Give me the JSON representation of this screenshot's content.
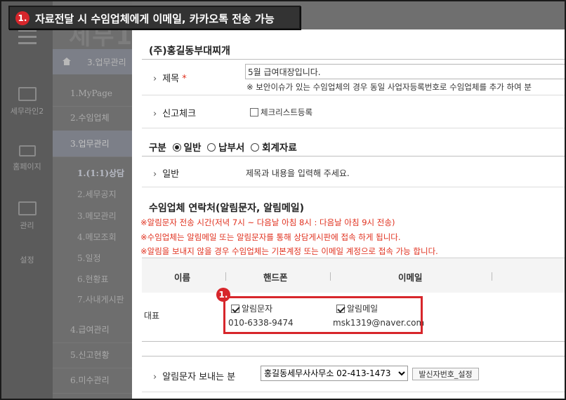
{
  "annotation": {
    "number": "1.",
    "banner_text": "자료전달 시 수임업체에게 이메일, 카카오톡 전송 가능"
  },
  "brand_partial": "세무1",
  "rail": {
    "items": [
      {
        "label": "세무라인2",
        "icon": "document-icon"
      },
      {
        "label": "홈페이지",
        "icon": "monitor-icon"
      },
      {
        "label": "관리",
        "icon": "document-icon"
      },
      {
        "label": "설정",
        "icon": "gear-icon"
      }
    ]
  },
  "breadcrumb": {
    "label": "3.업무관리"
  },
  "sidebar": {
    "items": [
      "1.MyPage",
      "2.수임업체",
      "3.업무관리"
    ],
    "sub_items": [
      "1.(1:1)상담",
      "2.세무공지",
      "3.메모관리",
      "4.메모조회",
      "5.일정",
      "6.현황표",
      "7.사내게시판"
    ],
    "lower_items": [
      "4.급여관리",
      "5.신고현황",
      "6.미수관리"
    ]
  },
  "form": {
    "company_title": "(주)홍길동부대찌개",
    "subject_label": "제목",
    "required_mark": "*",
    "subject_value": "5월 급여대장입니다.",
    "subject_note": "※ 보안이슈가 있는 수임업체의 경우 동일 사업자등록번호로 수임업체를 추가 하여 분",
    "check_label": "신고체크",
    "checklist_option": "체크리스트등록",
    "type_label": "구분",
    "type_options": [
      "일반",
      "납부서",
      "회계자료"
    ],
    "general_label": "일반",
    "general_placeholder": "제목과 내용을 입력해 주세요."
  },
  "contact": {
    "title": "수임업체 연락처(알림문자, 알림메일)",
    "notes": [
      "※알림문자 전송 시간(저녁 7시 ~ 다음날 아침 8시 : 다음날 아침 9시 전송)",
      "※수임업체는 알림메일 또는 알림문자를 통해 상담게시판에 접속 하게 됩니다.",
      "※알림을 보내지 않을 경우 수임업체는 기본계정 또는 이메일 계정으로 접속 가능 합니다."
    ],
    "columns": [
      "이름",
      "핸드폰",
      "이메일"
    ],
    "row": {
      "name": "대표",
      "sms_label": "알림문자",
      "sms_checked": true,
      "phone": "010-6338-9474",
      "mail_label": "알림메일",
      "mail_checked": true,
      "email": "msk1319@naver.com"
    }
  },
  "sender": {
    "label": "알림문자 보내는 분",
    "selected": "홍길동세무사사무소 02-413-1473",
    "button": "발신자번호_설정"
  },
  "colors": {
    "highlight": "#d7262b",
    "note_red": "#e0301e",
    "banner_bg": "#333333"
  }
}
